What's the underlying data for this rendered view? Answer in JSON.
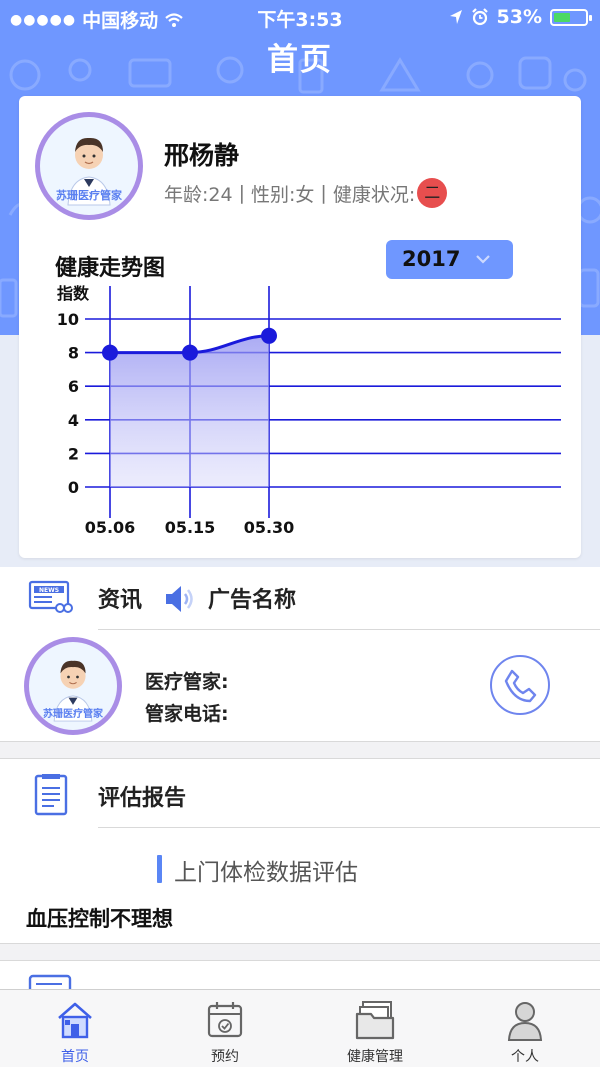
{
  "status_bar": {
    "carrier": "中国移动",
    "time": "下午3:53",
    "battery": "53%"
  },
  "nav": {
    "title": "首页"
  },
  "profile": {
    "avatar_brand": "苏珊医疗管家",
    "name": "邢杨静",
    "age_label": "年龄:24",
    "gender_label": "性别:女",
    "health_label": "健康状况:",
    "health_value": "二",
    "separator": "|"
  },
  "trend": {
    "title": "健康走势图",
    "year": "2017"
  },
  "chart_data": {
    "type": "area",
    "title": "健康走势图",
    "ylabel": "指数",
    "x": [
      "05.06",
      "05.15",
      "05.30"
    ],
    "values": [
      8,
      8,
      9
    ],
    "yticks": [
      "10",
      "8",
      "6",
      "4",
      "2",
      "0"
    ],
    "ylim": [
      0,
      10
    ],
    "grid": true,
    "line_color": "#1a1adb"
  },
  "news": {
    "label": "资讯",
    "ad_text": "广告名称"
  },
  "manager": {
    "avatar_brand": "苏珊医疗管家",
    "butler_label": "医疗管家:",
    "phone_label": "管家电话:"
  },
  "report": {
    "label": "评估报告",
    "subtitle": "上门体检数据评估",
    "result": "血压控制不理想"
  },
  "tabs": [
    {
      "label": "首页",
      "icon": "home-icon",
      "active": true
    },
    {
      "label": "预约",
      "icon": "calendar-icon",
      "active": false
    },
    {
      "label": "健康管理",
      "icon": "folder-icon",
      "active": false
    },
    {
      "label": "个人",
      "icon": "person-icon",
      "active": false
    }
  ],
  "colors": {
    "brand": "#6f97ff",
    "accent": "#3f60e8",
    "status_red": "#e74e4e"
  }
}
